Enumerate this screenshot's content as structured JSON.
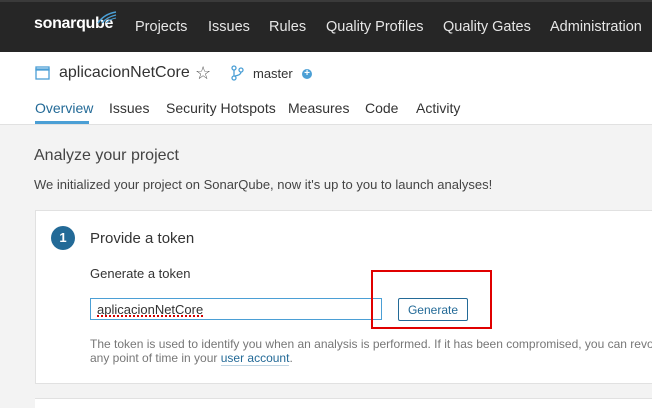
{
  "topbar": {
    "logo_text": "sonarqube",
    "nav": [
      "Projects",
      "Issues",
      "Rules",
      "Quality Profiles",
      "Quality Gates",
      "Administration"
    ]
  },
  "project": {
    "name": "aplicacionNetCore",
    "branch": "master",
    "tabs": [
      "Overview",
      "Issues",
      "Security Hotspots",
      "Measures",
      "Code",
      "Activity"
    ],
    "active_tab": "Overview"
  },
  "main": {
    "title": "Analyze your project",
    "description": "We initialized your project on SonarQube, now it's up to you to launch analyses!",
    "step": {
      "number": "1",
      "title": "Provide a token",
      "generate_label": "Generate a token",
      "token_value": "aplicacionNetCore",
      "generate_button": "Generate",
      "hint_line1": "The token is used to identify you when an analysis is performed. If it has been compromised, you can revo",
      "hint_line2_prefix": "any point of time in your ",
      "hint_link": "user account",
      "hint_suffix": "."
    }
  },
  "colors": {
    "topbar_bg": "#262626",
    "accent": "#236a97",
    "highlight_red": "#e00000"
  }
}
